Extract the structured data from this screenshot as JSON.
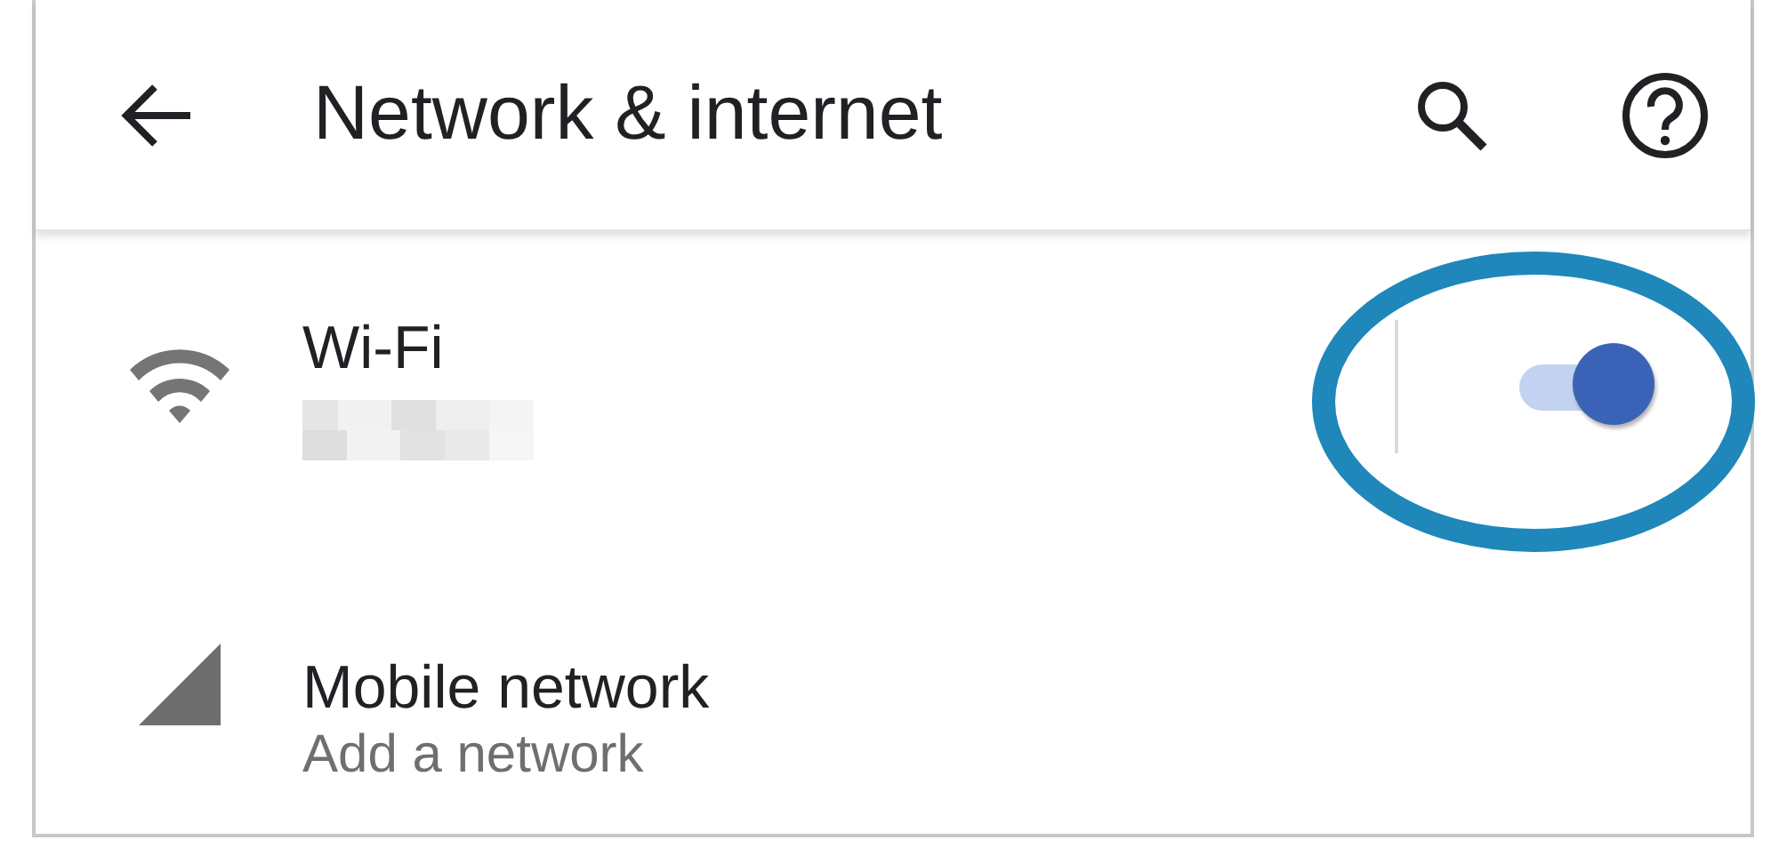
{
  "app_bar": {
    "title": "Network & internet"
  },
  "items": [
    {
      "kind": "wifi",
      "title": "Wi-Fi",
      "subtitle_redacted": true,
      "toggle": {
        "on": true
      }
    },
    {
      "kind": "mobile",
      "title": "Mobile network",
      "subtitle": "Add a network"
    }
  ]
}
